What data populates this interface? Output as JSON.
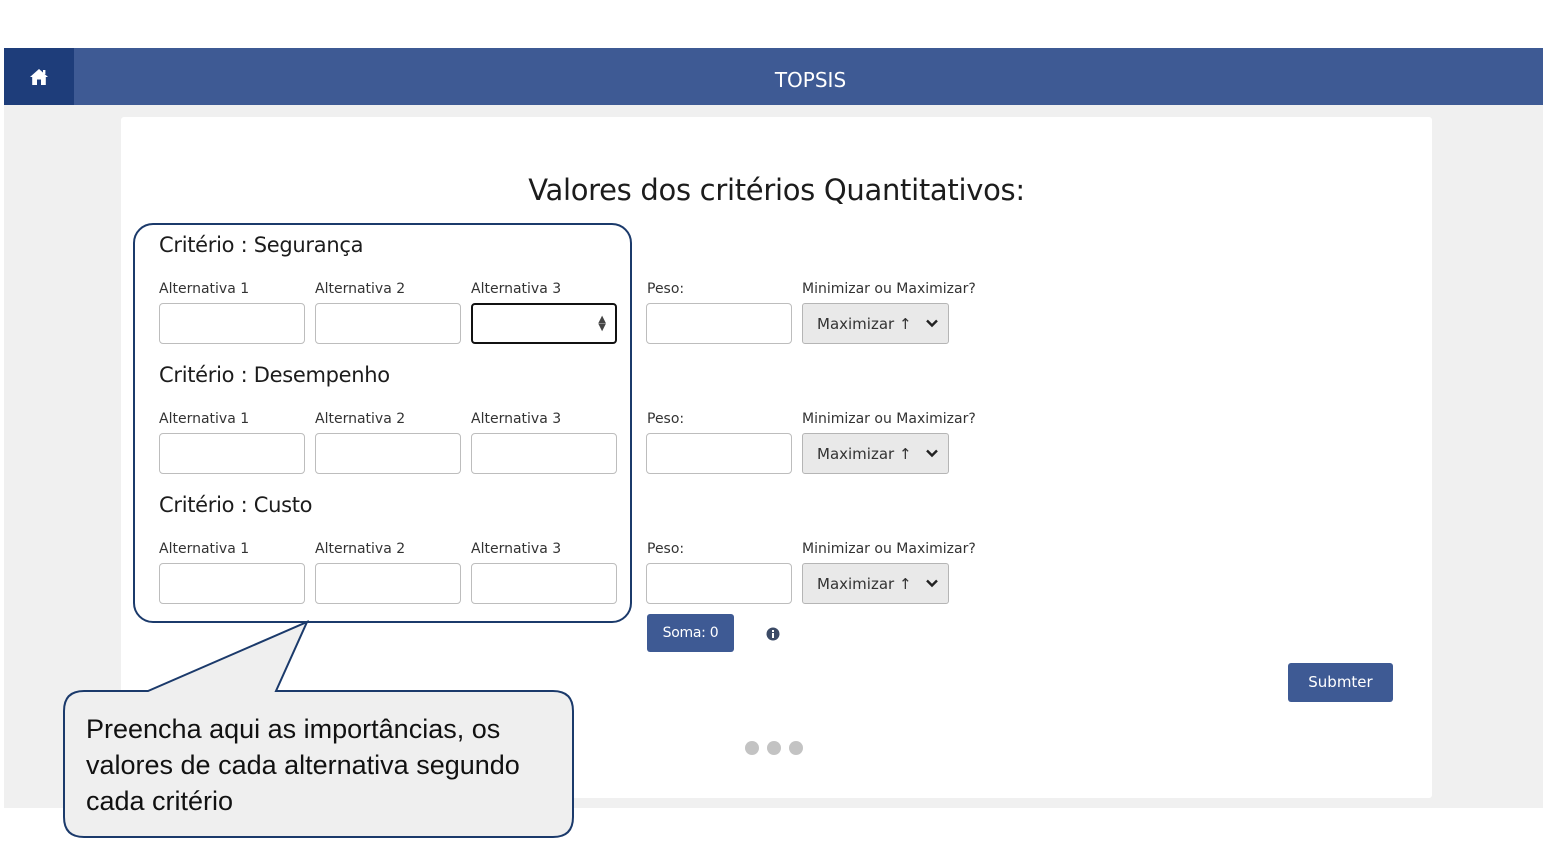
{
  "navbar": {
    "title": "TOPSIS",
    "home_icon": "home-icon"
  },
  "heading": "Valores dos critérios Quantitativos:",
  "labels": {
    "alt1": "Alternativa 1",
    "alt2": "Alternativa 2",
    "alt3": "Alternativa 3",
    "peso": "Peso:",
    "minmax": "Minimizar ou Maximizar?"
  },
  "criteria": [
    {
      "title": "Critério : Segurança",
      "alt1": "",
      "alt2": "",
      "alt3": "",
      "peso": "",
      "minmax": "Maximizar ↑"
    },
    {
      "title": "Critério : Desempenho",
      "alt1": "",
      "alt2": "",
      "alt3": "",
      "peso": "",
      "minmax": "Maximizar ↑"
    },
    {
      "title": "Critério : Custo",
      "alt1": "",
      "alt2": "",
      "alt3": "",
      "peso": "",
      "minmax": "Maximizar ↑"
    }
  ],
  "soma_button": "Soma: 0",
  "submit_button": "Submter",
  "carousel": {
    "count": 3
  },
  "callout": "Preencha aqui as importâncias, os valores de cada alternativa segundo cada critério",
  "colors": {
    "navbar": "#3e5a94",
    "home_button": "#1e3d7a",
    "button": "#3e5a94",
    "callout_border": "#1b3a6b",
    "callout_fill": "#efefef"
  }
}
